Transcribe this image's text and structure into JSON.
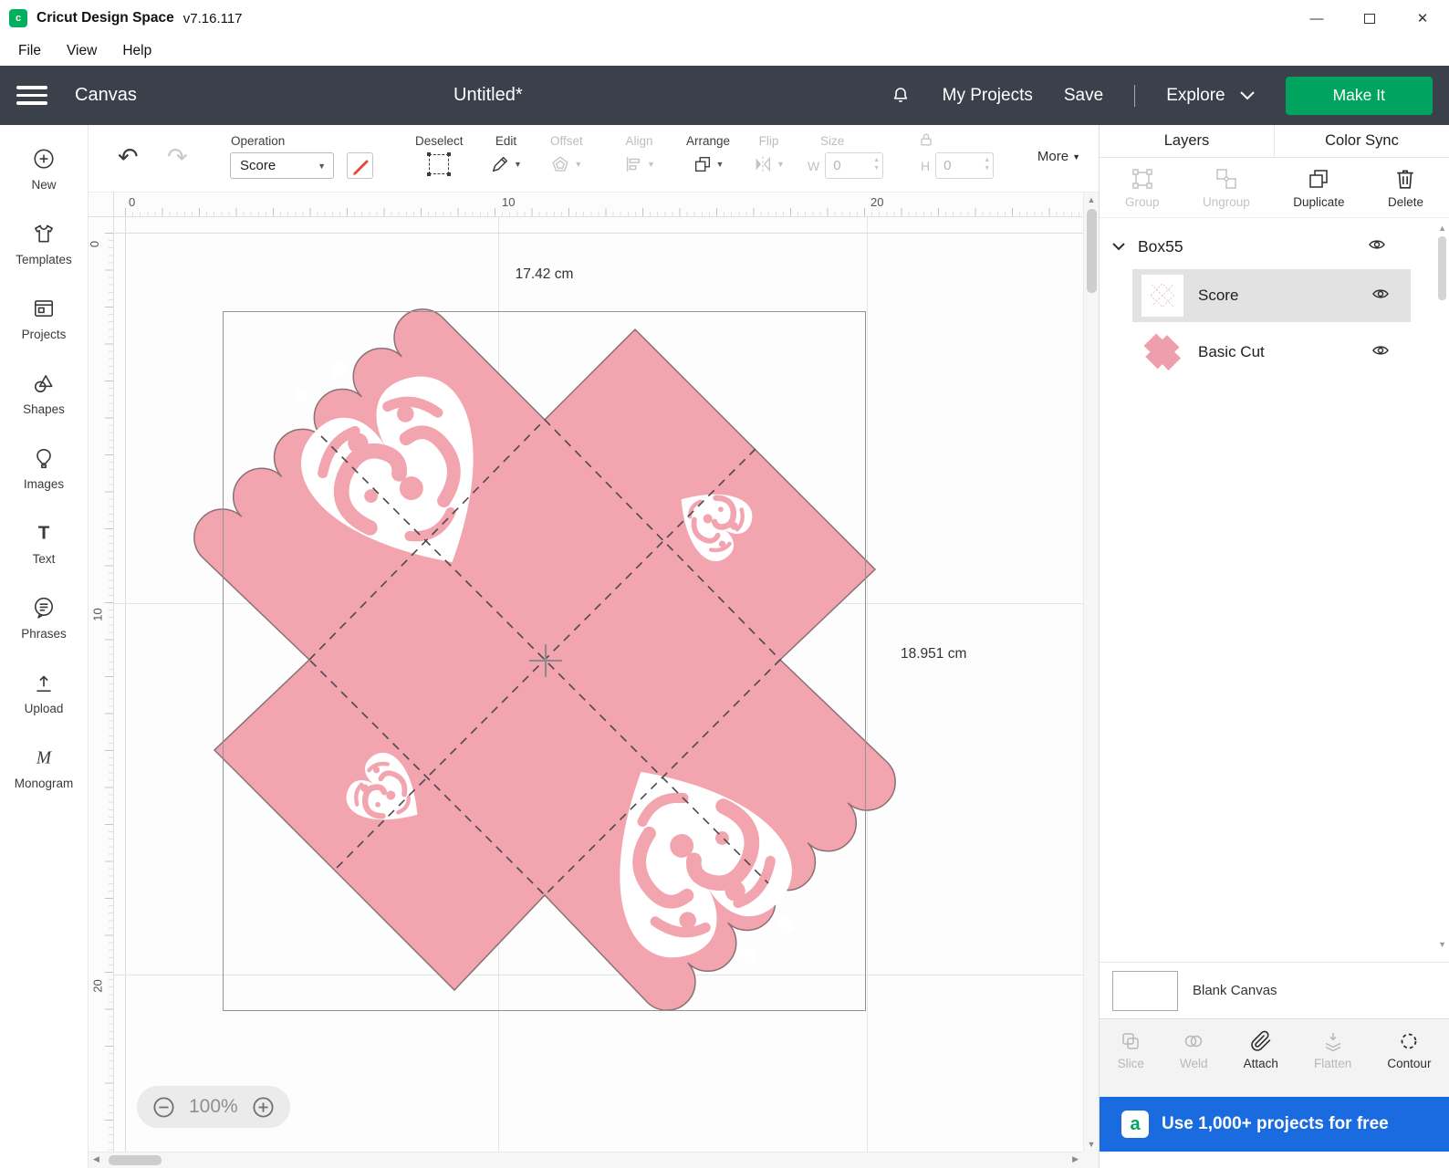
{
  "titlebar": {
    "title": "Cricut Design Space",
    "version": "v7.16.117"
  },
  "menubar": {
    "items": [
      "File",
      "View",
      "Help"
    ]
  },
  "header": {
    "canvas_label": "Canvas",
    "document_title": "Untitled*",
    "my_projects_label": "My Projects",
    "save_label": "Save",
    "explore_label": "Explore",
    "make_it_label": "Make It"
  },
  "sidebar": {
    "items": [
      {
        "label": "New",
        "icon": "plus-circle-icon"
      },
      {
        "label": "Templates",
        "icon": "shirt-icon"
      },
      {
        "label": "Projects",
        "icon": "project-card-icon"
      },
      {
        "label": "Shapes",
        "icon": "shapes-icon"
      },
      {
        "label": "Images",
        "icon": "balloon-icon"
      },
      {
        "label": "Text",
        "icon": "text-icon"
      },
      {
        "label": "Phrases",
        "icon": "speech-bubble-icon"
      },
      {
        "label": "Upload",
        "icon": "upload-arrow-icon"
      },
      {
        "label": "Monogram",
        "icon": "monogram-icon"
      }
    ]
  },
  "toolbar": {
    "operation_label": "Operation",
    "operation_value": "Score",
    "deselect_label": "Deselect",
    "edit_label": "Edit",
    "offset_label": "Offset",
    "align_label": "Align",
    "arrange_label": "Arrange",
    "flip_label": "Flip",
    "size_label": "Size",
    "w_label": "W",
    "w_value": "0",
    "h_label": "H",
    "h_value": "0",
    "more_label": "More"
  },
  "canvas": {
    "ruler_h": [
      "0",
      "10",
      "20"
    ],
    "ruler_v": [
      "0",
      "10",
      "20"
    ],
    "selection_width": "17.42 cm",
    "selection_height": "18.951 cm",
    "zoom_value": "100%"
  },
  "layers_panel": {
    "tab_layers": "Layers",
    "tab_color_sync": "Color Sync",
    "actions": [
      {
        "label": "Group",
        "enabled": false
      },
      {
        "label": "Ungroup",
        "enabled": false
      },
      {
        "label": "Duplicate",
        "enabled": true
      },
      {
        "label": "Delete",
        "enabled": true
      }
    ],
    "group_name": "Box55",
    "layers": [
      {
        "name": "Score",
        "selected": true
      },
      {
        "name": "Basic Cut",
        "selected": false
      }
    ],
    "blank_canvas_label": "Blank Canvas",
    "tools": [
      {
        "label": "Slice",
        "enabled": false
      },
      {
        "label": "Weld",
        "enabled": false
      },
      {
        "label": "Attach",
        "enabled": true
      },
      {
        "label": "Flatten",
        "enabled": false
      },
      {
        "label": "Contour",
        "enabled": true
      }
    ],
    "banner_text": "Use 1,000+ projects for free"
  },
  "colors": {
    "header_bg": "#3a414b",
    "accent_green": "#00a45f",
    "design_pink": "#f2a4af",
    "banner_blue": "#1a6be0",
    "score_red": "#e04a3f"
  }
}
